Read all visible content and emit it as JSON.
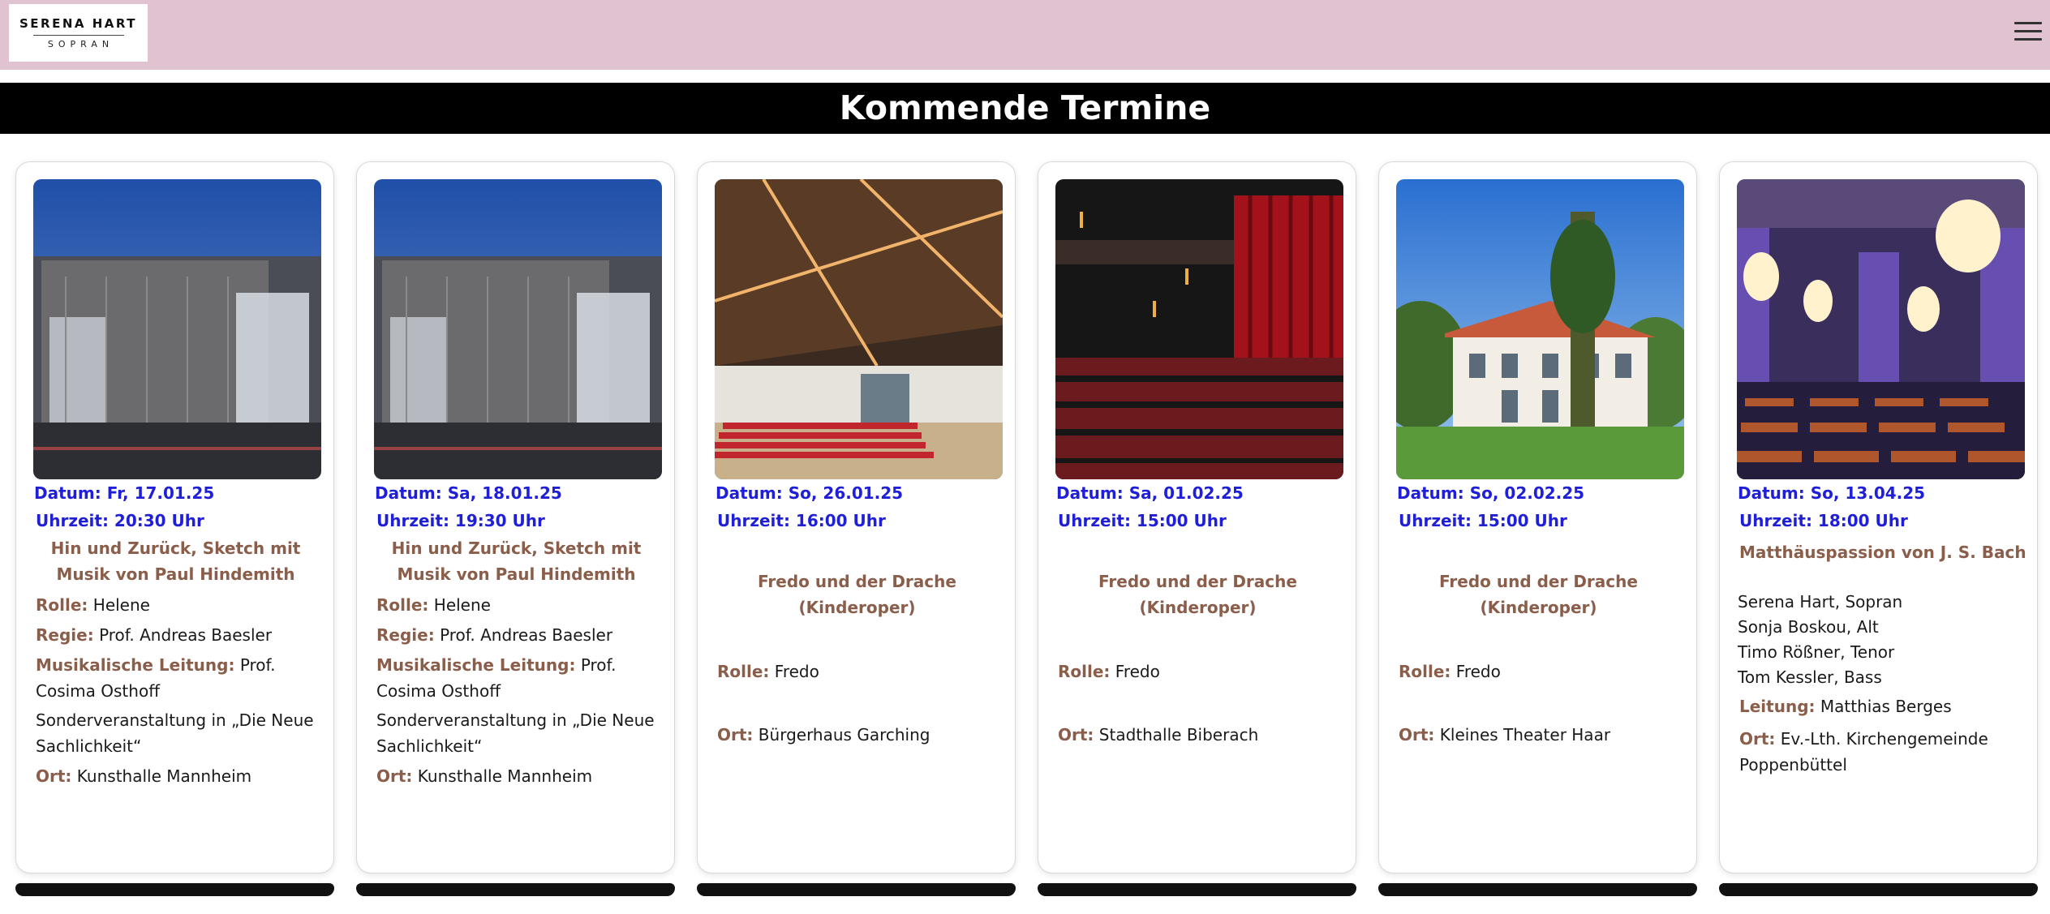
{
  "header": {
    "logo_name": "SERENA HART",
    "logo_sub": "SOPRAN",
    "menu_icon": "hamburger-icon",
    "background": "#e0c2d0"
  },
  "section": {
    "title": "Kommende Termine"
  },
  "colors": {
    "date_text": "#1f1fd8",
    "label_text": "#8a5e4a",
    "title_bar": "#000000"
  },
  "events": [
    {
      "image": "concert-hall-exterior-night",
      "date": "Datum: Fr, 17.01.25",
      "time": "Uhrzeit: 20:30 Uhr",
      "title": "Hin und Zurück, Sketch mit Musik von Paul Hindemith",
      "role_label": "Rolle:",
      "role": "Helene",
      "direction_label": "Regie:",
      "direction": "Prof. Andreas Baesler",
      "music_label": "Musikalische Leitung:",
      "music": "Prof. Cosima Osthoff",
      "note": "Sonderveranstaltung in „Die Neue Sachlichkeit“",
      "venue_label": "Ort:",
      "venue": "Kunsthalle Mannheim"
    },
    {
      "image": "concert-hall-exterior-night",
      "date": "Datum: Sa, 18.01.25",
      "time": "Uhrzeit: 19:30 Uhr",
      "title": "Hin und Zurück, Sketch mit Musik von Paul Hindemith",
      "role_label": "Rolle:",
      "role": "Helene",
      "direction_label": "Regie:",
      "direction": "Prof. Andreas Baesler",
      "music_label": "Musikalische Leitung:",
      "music": "Prof. Cosima Osthoff",
      "note": "Sonderveranstaltung in „Die Neue Sachlichkeit“",
      "venue_label": "Ort:",
      "venue": "Kunsthalle Mannheim"
    },
    {
      "image": "wooden-roof-hall-interior",
      "date": "Datum: So, 26.01.25",
      "time": "Uhrzeit: 16:00 Uhr",
      "title": "Fredo und der Drache (Kinderoper)",
      "role_label": "Rolle:",
      "role": "Fredo",
      "venue_label": "Ort:",
      "venue": "Bürgerhaus Garching"
    },
    {
      "image": "theatre-auditorium-red-curtain",
      "date": "Datum: Sa, 01.02.25",
      "time": "Uhrzeit: 15:00 Uhr",
      "title": "Fredo und der Drache (Kinderoper)",
      "role_label": "Rolle:",
      "role": "Fredo",
      "venue_label": "Ort:",
      "venue": "Stadthalle Biberach"
    },
    {
      "image": "villa-theatre-exterior",
      "date": "Datum: So, 02.02.25",
      "time": "Uhrzeit: 15:00 Uhr",
      "title": "Fredo und der Drache (Kinderoper)",
      "role_label": "Rolle:",
      "role": "Fredo",
      "venue_label": "Ort:",
      "venue": "Kleines Theater Haar"
    },
    {
      "image": "baroque-hall-chandeliers",
      "date": "Datum: So, 13.04.25",
      "time": "Uhrzeit: 18:00 Uhr",
      "title": "Matthäuspassion von J. S. Bach",
      "cast": [
        "Serena Hart, Sopran",
        "Sonja Boskou, Alt",
        "Timo Rößner, Tenor",
        "Tom Kessler, Bass"
      ],
      "lead_label": "Leitung:",
      "lead": "Matthias Berges",
      "venue_label": "Ort:",
      "venue": "Ev.-Lth. Kirchengemeinde Poppenbüttel"
    }
  ]
}
